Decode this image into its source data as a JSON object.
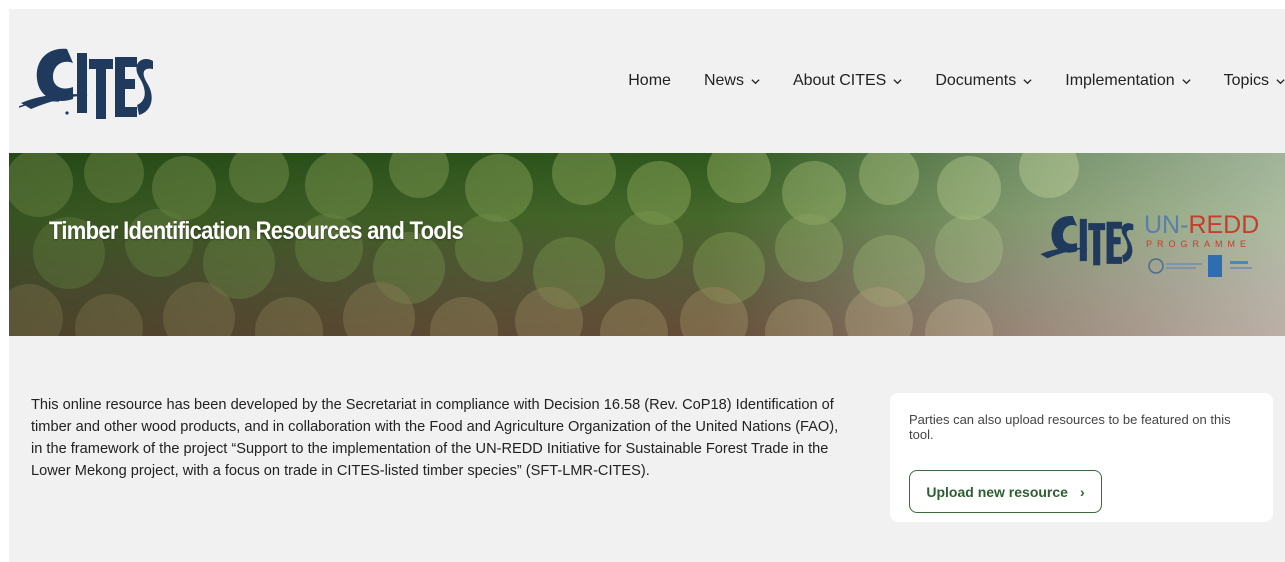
{
  "header": {
    "logo_alt": "CITES",
    "nav": [
      {
        "label": "Home",
        "has_dropdown": false
      },
      {
        "label": "News",
        "has_dropdown": true
      },
      {
        "label": "About CITES",
        "has_dropdown": true
      },
      {
        "label": "Documents",
        "has_dropdown": true
      },
      {
        "label": "Implementation",
        "has_dropdown": true
      },
      {
        "label": "Topics",
        "has_dropdown": true
      }
    ]
  },
  "hero": {
    "title": "Timber Identification Resources and Tools",
    "partner_un": "UN-",
    "partner_redd": "REDD",
    "partner_programme": "PROGRAMME"
  },
  "intro": {
    "text": "This online resource has been developed by the Secretariat in compliance with Decision 16.58 (Rev. CoP18) Identification of timber and other wood products, and in collaboration with the Food and Agriculture Organization of the United Nations (FAO), in the framework of the project “Support to the implementation of the UN-REDD Initiative for Sustainable Forest Trade in the Lower Mekong project, with a focus on trade in CITES-listed timber species” (SFT-LMR-CITES)."
  },
  "upload": {
    "text": "Parties can also upload resources to be featured on this tool.",
    "button_label": "Upload new resource",
    "button_arrow": "›"
  },
  "colors": {
    "cites_blue": "#1f3a5c",
    "button_green": "#3b6b3a",
    "redd_red": "#c2402a",
    "un_blue": "#5a7fa8"
  }
}
